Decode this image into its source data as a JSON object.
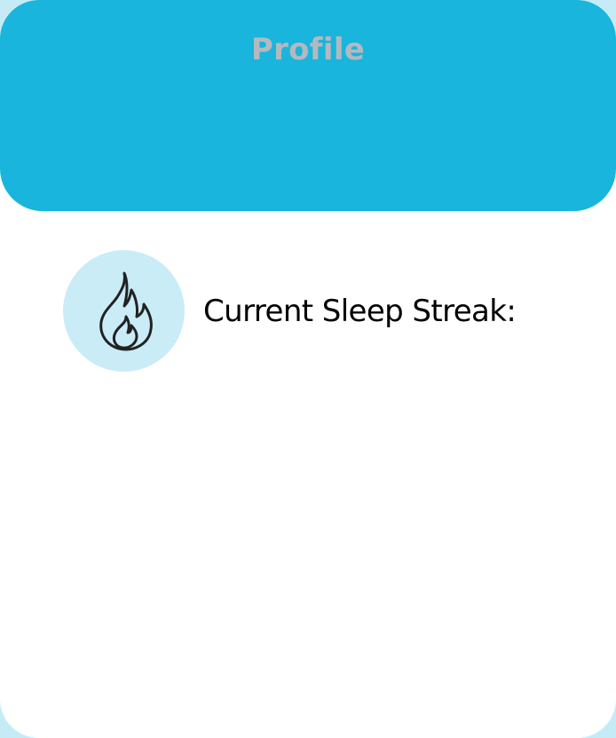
{
  "header": {
    "title": "Profile"
  },
  "streak": {
    "label": "Current Sleep Streak:",
    "icon": "flame-icon"
  },
  "colors": {
    "header_bg": "#19b5dc",
    "header_title": "#b4b9bf",
    "icon_circle_bg": "#c9ecf7",
    "page_bg": "#ffffff",
    "outer_bg": "#c5ecf6"
  }
}
